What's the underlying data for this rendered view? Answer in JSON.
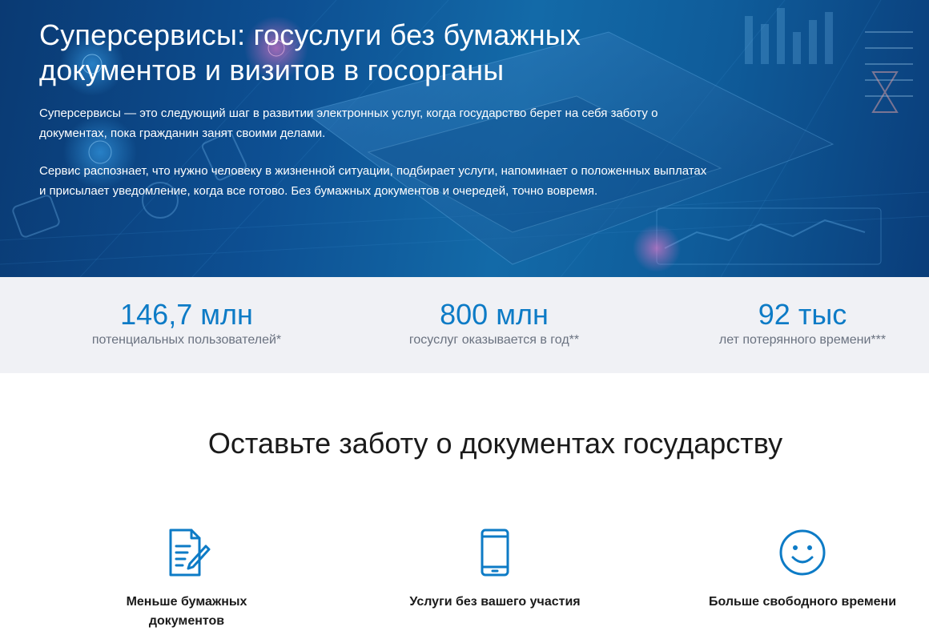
{
  "hero": {
    "title": "Суперсервисы: госуслуги без бумажных документов и визитов в госорганы",
    "paragraph_1": "Суперсервисы — это следующий шаг в развитии электронных услуг, когда государство берет на себя заботу о документах, пока гражданин занят своими делами.",
    "paragraph_2": "Сервис распознает, что нужно человеку в жизненной ситуации, подбирает услуги, напоминает о положенных выплатах и присылает уведомление, когда все готово. Без бумажных документов и очередей, точно вовремя."
  },
  "stats": [
    {
      "value": "146,7 млн",
      "caption": "потенциальных пользователей*"
    },
    {
      "value": "800 млн",
      "caption": "госуслуг оказывается в год**"
    },
    {
      "value": "92 тыс",
      "caption": "лет потерянного времени***"
    }
  ],
  "section": {
    "title": "Оставьте заботу о документах государству"
  },
  "features": [
    {
      "icon": "document-pen-icon",
      "label": "Меньше бумажных документов"
    },
    {
      "icon": "smartphone-icon",
      "label": "Услуги без вашего участия"
    },
    {
      "icon": "smiley-icon",
      "label": "Больше свободного времени"
    }
  ],
  "colors": {
    "accent": "#0d7bc6",
    "hero_bg": "#0d4f92",
    "stats_bg": "#f0f1f5",
    "caption": "#6a7280",
    "text_dark": "#1a1a1a"
  }
}
